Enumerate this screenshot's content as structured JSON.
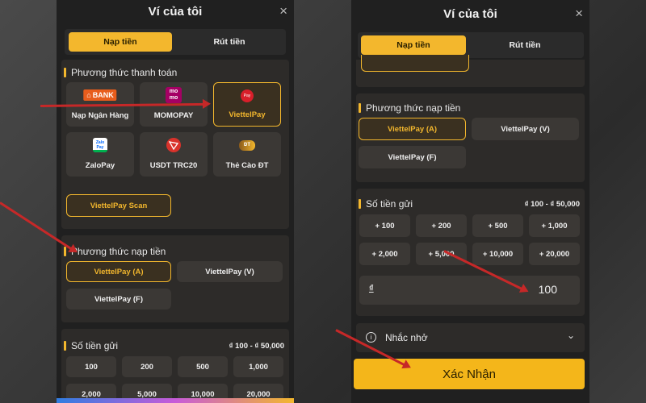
{
  "wallet": {
    "title": "Ví của tôi",
    "close": "×"
  },
  "tabs": {
    "deposit": "Nạp tiền",
    "withdraw": "Rút tiền"
  },
  "payment_section": {
    "title": "Phương thức thanh toán",
    "methods": [
      {
        "label": "Nạp Ngân Hàng",
        "icon": "bank-icon",
        "icon_text": "BANK"
      },
      {
        "label": "MOMOPAY",
        "icon": "momo-icon",
        "icon_text": "mo mo"
      },
      {
        "label": "ViettelPay",
        "icon": "viettelpay-icon",
        "icon_text": "Pay"
      },
      {
        "label": "ZaloPay",
        "icon": "zalopay-icon",
        "icon_text": "Zalo Pay"
      },
      {
        "label": "USDT TRC20",
        "icon": "tron-icon",
        "icon_text": ""
      },
      {
        "label": "Thẻ Cào ĐT",
        "icon": "scratch-card-icon",
        "icon_text": "ĐT"
      }
    ],
    "scan_button": "ViettelPay Scan"
  },
  "deposit_method": {
    "title": "Phương thức nạp tiền",
    "options": [
      "ViettelPay (A)",
      "ViettelPay (V)",
      "ViettelPay (F)"
    ]
  },
  "amount_left": {
    "title": "Số tiền gửi",
    "range": "₫ 100 - ₫ 50,000",
    "options": [
      "100",
      "200",
      "500",
      "1,000",
      "2,000",
      "5,000",
      "10,000",
      "20,000"
    ]
  },
  "amount_right": {
    "title": "Số tiền gửi",
    "range": "₫ 100 - ₫ 50,000",
    "options": [
      "+ 100",
      "+ 200",
      "+ 500",
      "+ 1,000",
      "+ 2,000",
      "+ 5,000",
      "+ 10,000",
      "+ 20,000"
    ],
    "currency_symbol": "₫",
    "value": "100"
  },
  "reminder": {
    "label": "Nhắc nhở",
    "icon": "info-icon"
  },
  "confirm_button": "Xác Nhận",
  "colors": {
    "accent": "#f3b72d",
    "arrow": "#c62828",
    "panel": "#202020"
  }
}
